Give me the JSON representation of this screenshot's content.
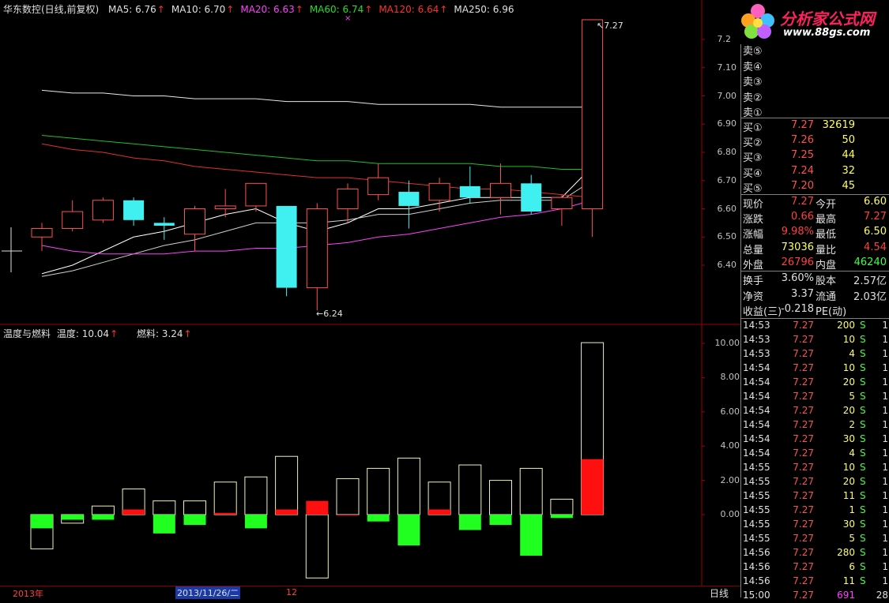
{
  "header": {
    "stock_name": "华东数控(日线,前复权)",
    "ma_items": [
      {
        "label": "MA5: 6.76",
        "color": "#e0e0e0",
        "arrow": "↑"
      },
      {
        "label": "MA10: 6.70",
        "color": "#e0e0e0",
        "arrow": "↑"
      },
      {
        "label": "MA20: 6.63",
        "color": "#ff40ff",
        "arrow": "↑"
      },
      {
        "label": "MA60: 6.74",
        "color": "#20e020",
        "arrow": "↑"
      },
      {
        "label": "MA120: 6.64",
        "color": "#ff3030",
        "arrow": "↑"
      },
      {
        "label": "MA250: 6.96",
        "color": "#e0e0e0",
        "arrow": ""
      }
    ]
  },
  "indicator_header": {
    "name": "温度与燃料",
    "temp": "温度: 10.04",
    "fuel": "燃料: 3.24",
    "arrow": "↑"
  },
  "logo": {
    "title": "分析家公式网",
    "url": "www.88gs.com"
  },
  "annotations": {
    "high": "7.27",
    "low": "6.24"
  },
  "price_axis": [
    "7.20",
    "7.10",
    "7.00",
    "6.90",
    "6.80",
    "6.70",
    "6.60",
    "6.50",
    "6.40"
  ],
  "indicator_axis": [
    "10.00",
    "8.00",
    "6.00",
    "4.00",
    "2.00",
    "0.00"
  ],
  "bottom_bar": {
    "year": "2013年",
    "date": "2013/11/26/二",
    "month": "12",
    "period": "日线"
  },
  "chart_data": {
    "type": "candlestick",
    "candles": [
      {
        "o": 6.5,
        "c": 6.53,
        "h": 6.55,
        "l": 6.45
      },
      {
        "o": 6.53,
        "c": 6.59,
        "h": 6.63,
        "l": 6.52
      },
      {
        "o": 6.56,
        "c": 6.63,
        "h": 6.64,
        "l": 6.55
      },
      {
        "o": 6.63,
        "c": 6.56,
        "h": 6.64,
        "l": 6.54
      },
      {
        "o": 6.55,
        "c": 6.54,
        "h": 6.57,
        "l": 6.49
      },
      {
        "o": 6.51,
        "c": 6.6,
        "h": 6.61,
        "l": 6.45
      },
      {
        "o": 6.6,
        "c": 6.61,
        "h": 6.67,
        "l": 6.57
      },
      {
        "o": 6.61,
        "c": 6.69,
        "h": 6.69,
        "l": 6.59
      },
      {
        "o": 6.61,
        "c": 6.32,
        "h": 6.61,
        "l": 6.29
      },
      {
        "o": 6.32,
        "c": 6.6,
        "h": 6.62,
        "l": 6.24
      },
      {
        "o": 6.6,
        "c": 6.67,
        "h": 6.69,
        "l": 6.55
      },
      {
        "o": 6.65,
        "c": 6.71,
        "h": 6.76,
        "l": 6.63
      },
      {
        "o": 6.66,
        "c": 6.61,
        "h": 6.7,
        "l": 6.53
      },
      {
        "o": 6.63,
        "c": 6.69,
        "h": 6.71,
        "l": 6.59
      },
      {
        "o": 6.68,
        "c": 6.64,
        "h": 6.75,
        "l": 6.62
      },
      {
        "o": 6.64,
        "c": 6.69,
        "h": 6.76,
        "l": 6.58
      },
      {
        "o": 6.69,
        "c": 6.59,
        "h": 6.72,
        "l": 6.58
      },
      {
        "o": 6.6,
        "c": 6.64,
        "h": 6.65,
        "l": 6.54
      },
      {
        "o": 6.6,
        "c": 7.27,
        "h": 7.27,
        "l": 6.5
      }
    ],
    "ma_lines": [
      {
        "name": "MA5",
        "color": "#ffffff",
        "values": [
          6.37,
          6.4,
          6.45,
          6.5,
          6.52,
          6.55,
          6.58,
          6.6,
          6.55,
          6.52,
          6.55,
          6.6,
          6.6,
          6.62,
          6.64,
          6.64,
          6.64,
          6.64,
          6.75
        ]
      },
      {
        "name": "MA10",
        "color": "#d0d0d0",
        "values": [
          6.36,
          6.38,
          6.41,
          6.44,
          6.47,
          6.49,
          6.52,
          6.55,
          6.55,
          6.55,
          6.56,
          6.58,
          6.58,
          6.6,
          6.62,
          6.63,
          6.63,
          6.63,
          6.7
        ]
      },
      {
        "name": "MA20",
        "color": "#ff40ff",
        "values": [
          6.47,
          6.45,
          6.44,
          6.44,
          6.44,
          6.45,
          6.45,
          6.46,
          6.46,
          6.47,
          6.48,
          6.5,
          6.51,
          6.53,
          6.55,
          6.57,
          6.58,
          6.6,
          6.63
        ]
      },
      {
        "name": "MA60",
        "color": "#20c020",
        "values": [
          6.86,
          6.85,
          6.84,
          6.83,
          6.82,
          6.81,
          6.8,
          6.79,
          6.78,
          6.77,
          6.77,
          6.76,
          6.76,
          6.76,
          6.76,
          6.75,
          6.75,
          6.74,
          6.74
        ]
      },
      {
        "name": "MA120",
        "color": "#e03030",
        "values": [
          6.83,
          6.81,
          6.8,
          6.78,
          6.77,
          6.75,
          6.74,
          6.73,
          6.72,
          6.71,
          6.71,
          6.7,
          6.69,
          6.68,
          6.67,
          6.67,
          6.66,
          6.65,
          6.64
        ]
      },
      {
        "name": "MA250",
        "color": "#e8e8e8",
        "values": [
          7.02,
          7.01,
          7.01,
          7.0,
          7.0,
          6.99,
          6.99,
          6.99,
          6.98,
          6.98,
          6.98,
          6.97,
          6.97,
          6.97,
          6.97,
          6.96,
          6.96,
          6.96,
          6.96
        ]
      }
    ],
    "indicator": {
      "temp": [
        -2.0,
        -0.5,
        0.5,
        1.5,
        0.8,
        0.8,
        1.9,
        2.2,
        3.4,
        -3.7,
        2.1,
        2.7,
        3.3,
        1.9,
        2.9,
        2.0,
        2.7,
        0.9,
        10.04
      ],
      "fuel": [
        -0.8,
        -0.3,
        -0.3,
        0.3,
        -1.1,
        -0.6,
        0.1,
        -0.8,
        0.3,
        0.8,
        0.0,
        -0.4,
        -1.8,
        0.3,
        -0.9,
        -0.6,
        -2.4,
        -0.2,
        3.24
      ]
    },
    "price_range": [
      6.24,
      7.27
    ],
    "indicator_range": [
      -3.7,
      10.04
    ]
  },
  "quote_panel": {
    "sell": [
      {
        "label": "卖⑤",
        "price": "",
        "vol": ""
      },
      {
        "label": "卖④",
        "price": "",
        "vol": ""
      },
      {
        "label": "卖③",
        "price": "",
        "vol": ""
      },
      {
        "label": "卖②",
        "price": "",
        "vol": ""
      },
      {
        "label": "卖①",
        "price": "",
        "vol": ""
      }
    ],
    "buy": [
      {
        "label": "买①",
        "price": "7.27",
        "vol": "32619"
      },
      {
        "label": "买②",
        "price": "7.26",
        "vol": "50"
      },
      {
        "label": "买③",
        "price": "7.25",
        "vol": "44"
      },
      {
        "label": "买④",
        "price": "7.24",
        "vol": "32"
      },
      {
        "label": "买⑤",
        "price": "7.20",
        "vol": "45"
      }
    ],
    "stats": [
      {
        "l1": "现价",
        "v1": "7.27",
        "c1": "#ff4040",
        "l2": "今开",
        "v2": "6.60",
        "c2": "#ffff60"
      },
      {
        "l1": "涨跌",
        "v1": "0.66",
        "c1": "#ff4040",
        "l2": "最高",
        "v2": "7.27",
        "c2": "#ff4040"
      },
      {
        "l1": "涨幅",
        "v1": "9.98%",
        "c1": "#ff4040",
        "l2": "最低",
        "v2": "6.50",
        "c2": "#ffff60"
      },
      {
        "l1": "总量",
        "v1": "73036",
        "c1": "#ffff60",
        "l2": "量比",
        "v2": "4.54",
        "c2": "#ff4040"
      },
      {
        "l1": "外盘",
        "v1": "26796",
        "c1": "#ff4040",
        "l2": "内盘",
        "v2": "46240",
        "c2": "#40ff40"
      }
    ],
    "fundamentals": [
      {
        "l1": "换手",
        "v1": "3.60%",
        "l2": "股本",
        "v2": "2.57亿"
      },
      {
        "l1": "净资",
        "v1": "3.37",
        "l2": "流通",
        "v2": "2.03亿"
      },
      {
        "l1": "收益(三)",
        "v1": "-0.218",
        "l2": "PE(动)",
        "v2": ""
      }
    ],
    "ticks": [
      {
        "time": "14:53",
        "price": "7.27",
        "vol": "200",
        "dir": "S",
        "n": "1"
      },
      {
        "time": "14:53",
        "price": "7.27",
        "vol": "10",
        "dir": "S",
        "n": "1"
      },
      {
        "time": "14:53",
        "price": "7.27",
        "vol": "4",
        "dir": "S",
        "n": "1"
      },
      {
        "time": "14:54",
        "price": "7.27",
        "vol": "10",
        "dir": "S",
        "n": "1"
      },
      {
        "time": "14:54",
        "price": "7.27",
        "vol": "20",
        "dir": "S",
        "n": "1"
      },
      {
        "time": "14:54",
        "price": "7.27",
        "vol": "5",
        "dir": "S",
        "n": "1"
      },
      {
        "time": "14:54",
        "price": "7.27",
        "vol": "20",
        "dir": "S",
        "n": "1"
      },
      {
        "time": "14:54",
        "price": "7.27",
        "vol": "2",
        "dir": "S",
        "n": "1"
      },
      {
        "time": "14:54",
        "price": "7.27",
        "vol": "30",
        "dir": "S",
        "n": "1"
      },
      {
        "time": "14:54",
        "price": "7.27",
        "vol": "4",
        "dir": "S",
        "n": "1"
      },
      {
        "time": "14:55",
        "price": "7.27",
        "vol": "10",
        "dir": "S",
        "n": "1"
      },
      {
        "time": "14:55",
        "price": "7.27",
        "vol": "20",
        "dir": "S",
        "n": "1"
      },
      {
        "time": "14:55",
        "price": "7.27",
        "vol": "11",
        "dir": "S",
        "n": "1"
      },
      {
        "time": "14:55",
        "price": "7.27",
        "vol": "1",
        "dir": "S",
        "n": "1"
      },
      {
        "time": "14:55",
        "price": "7.27",
        "vol": "30",
        "dir": "S",
        "n": "1"
      },
      {
        "time": "14:55",
        "price": "7.27",
        "vol": "5",
        "dir": "S",
        "n": "1"
      },
      {
        "time": "14:56",
        "price": "7.27",
        "vol": "280",
        "dir": "S",
        "n": "1"
      },
      {
        "time": "14:56",
        "price": "7.27",
        "vol": "6",
        "dir": "S",
        "n": "1"
      },
      {
        "time": "14:56",
        "price": "7.27",
        "vol": "11",
        "dir": "S",
        "n": "1"
      },
      {
        "time": "15:00",
        "price": "7.27",
        "vol": "691",
        "dir": "",
        "n": "28"
      }
    ]
  }
}
